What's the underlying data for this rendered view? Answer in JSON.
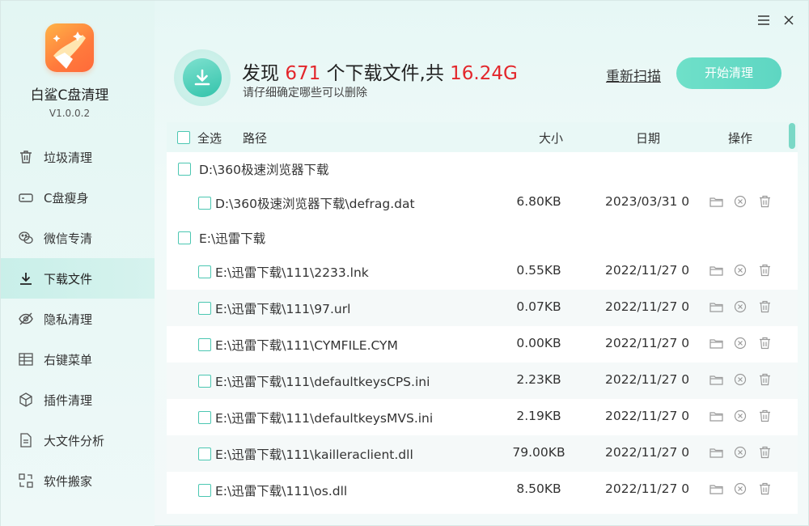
{
  "app": {
    "name": "白鲨C盘清理",
    "version": "V1.0.0.2"
  },
  "sidebar": {
    "items": [
      {
        "label": "垃圾清理",
        "icon": "trash-icon"
      },
      {
        "label": "C盘瘦身",
        "icon": "drive-icon"
      },
      {
        "label": "微信专清",
        "icon": "wechat-icon"
      },
      {
        "label": "下载文件",
        "icon": "download-icon",
        "active": true
      },
      {
        "label": "隐私清理",
        "icon": "eye-off-icon"
      },
      {
        "label": "右键菜单",
        "icon": "grid-icon"
      },
      {
        "label": "插件清理",
        "icon": "plugin-cube-icon"
      },
      {
        "label": "大文件分析",
        "icon": "document-icon"
      },
      {
        "label": "软件搬家",
        "icon": "move-icon"
      }
    ]
  },
  "header": {
    "prefix": "发现",
    "count": "671",
    "mid": "个下载文件,共",
    "total_size": "16.24G",
    "subtitle": "请仔细确定哪些可以删除",
    "rescan_label": "重新扫描",
    "start_label": "开始清理"
  },
  "table": {
    "columns": {
      "select_all": "全选",
      "path": "路径",
      "size": "大小",
      "date": "日期",
      "actions": "操作"
    },
    "rows": [
      {
        "type": "group",
        "path": "D:\\360极速浏览器下载"
      },
      {
        "type": "file",
        "path": "D:\\360极速浏览器下载\\defrag.dat",
        "size": "6.80KB",
        "date": "2023/03/31 0"
      },
      {
        "type": "group",
        "path": "E:\\迅雷下载"
      },
      {
        "type": "file",
        "path": "E:\\迅雷下载\\111\\2233.lnk",
        "size": "0.55KB",
        "date": "2022/11/27 0"
      },
      {
        "type": "file",
        "path": "E:\\迅雷下载\\111\\97.url",
        "size": "0.07KB",
        "date": "2022/11/27 0"
      },
      {
        "type": "file",
        "path": "E:\\迅雷下载\\111\\CYMFILE.CYM",
        "size": "0.00KB",
        "date": "2022/11/27 0"
      },
      {
        "type": "file",
        "path": "E:\\迅雷下载\\111\\defaultkeysCPS.ini",
        "size": "2.23KB",
        "date": "2022/11/27 0"
      },
      {
        "type": "file",
        "path": "E:\\迅雷下载\\111\\defaultkeysMVS.ini",
        "size": "2.19KB",
        "date": "2022/11/27 0"
      },
      {
        "type": "file",
        "path": "E:\\迅雷下载\\111\\kailleraclient.dll",
        "size": "79.00KB",
        "date": "2022/11/27 0"
      },
      {
        "type": "file",
        "path": "E:\\迅雷下载\\111\\os.dll",
        "size": "8.50KB",
        "date": "2022/11/27 0"
      }
    ]
  },
  "colors": {
    "accent": "#4cc7b2",
    "highlight_red": "#e3262b",
    "active_nav": "#c9efe9"
  }
}
